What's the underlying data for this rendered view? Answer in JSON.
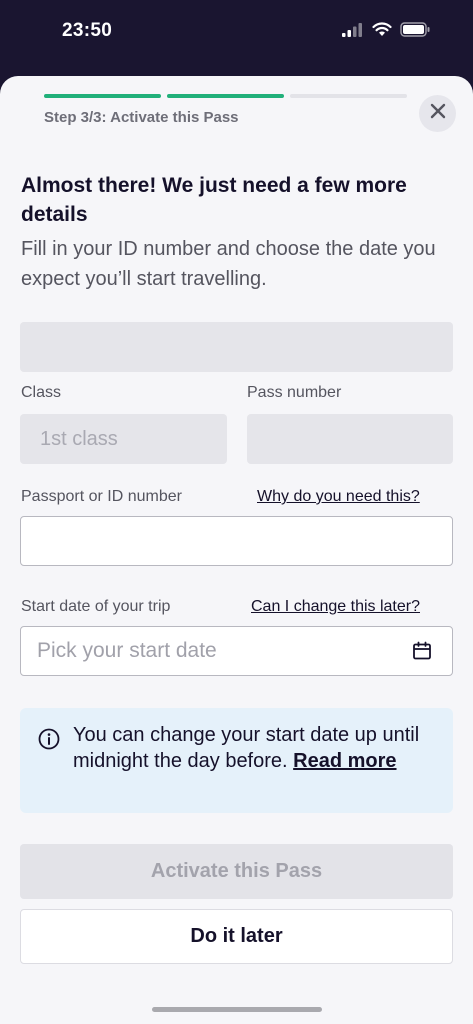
{
  "status_bar": {
    "time": "23:50",
    "icons": [
      "signal-icon",
      "wifi-icon",
      "battery-icon"
    ]
  },
  "progress": {
    "step_label": "Step 3/3: Activate this Pass",
    "steps_total": 3,
    "steps_completed": 2
  },
  "header": {
    "close_icon": "close-icon"
  },
  "content": {
    "heading": "Almost there! We just need a few more details",
    "subtitle": "Fill in your ID number and choose the date you expect you’ll start travelling."
  },
  "form": {
    "class_label": "Class",
    "class_value": "1st class",
    "pass_number_label": "Pass number",
    "pass_number_value": "",
    "passport_label": "Passport or ID number",
    "passport_help_link": "Why do you need this?",
    "passport_value": "",
    "start_date_label": "Start date of your trip",
    "start_date_help_link": "Can I change this later?",
    "start_date_placeholder": "Pick your start date"
  },
  "info": {
    "text": "You can change your start date up until midnight the day before. ",
    "link": "Read more"
  },
  "buttons": {
    "activate": "Activate this Pass",
    "later": "Do it later"
  },
  "colors": {
    "accent": "#21b07a",
    "text_primary": "#15112a",
    "info_background": "#e5f1fa",
    "status_bar": "#1a1530"
  }
}
